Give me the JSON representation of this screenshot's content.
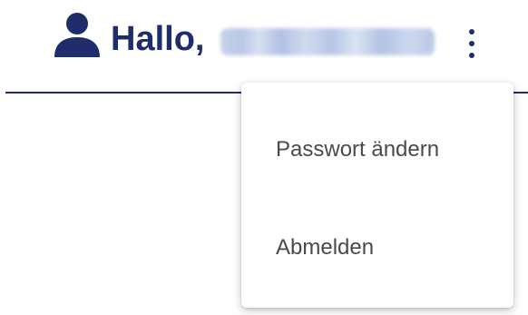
{
  "header": {
    "greeting": "Hallo,",
    "username": "Demo-demo",
    "user_icon": "user-icon",
    "menu_icon": "more-vert-icon",
    "accent_color": "#1f2d6b"
  },
  "menu": {
    "items": [
      {
        "label": "Passwort ändern"
      },
      {
        "label": "Abmelden"
      }
    ]
  }
}
